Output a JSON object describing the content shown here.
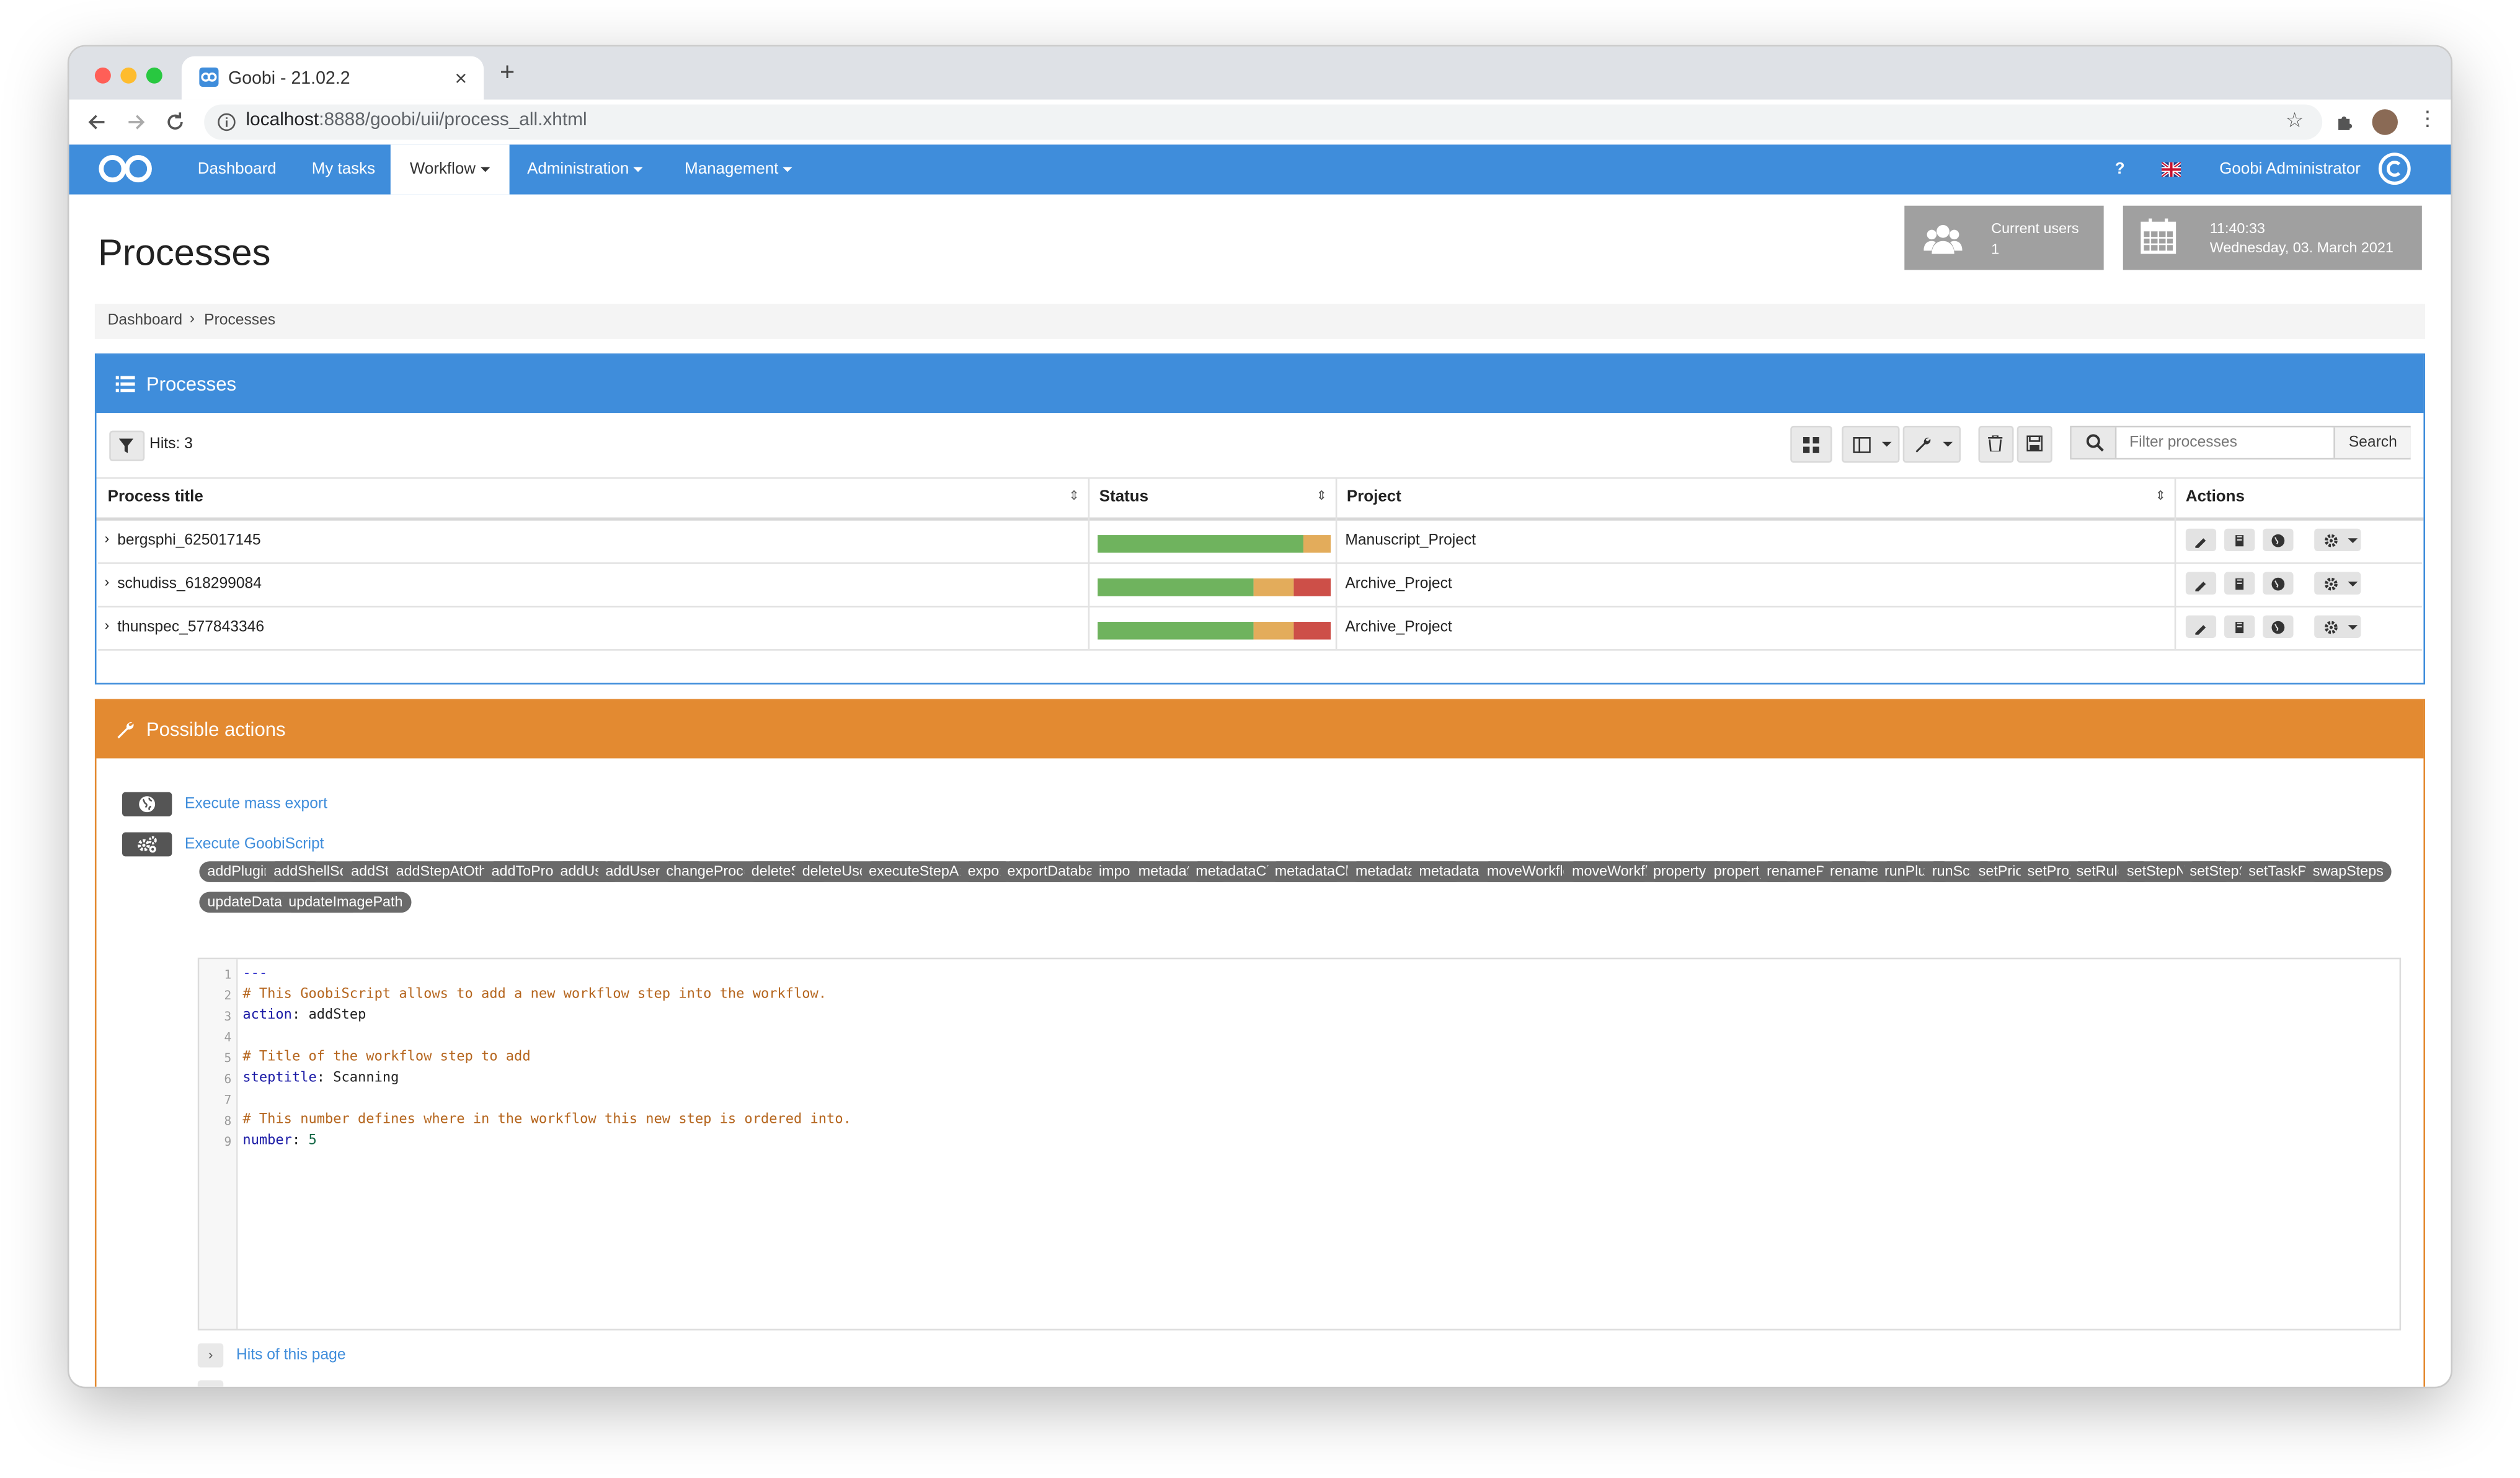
{
  "browser": {
    "tab_title": "Goobi - 21.02.2",
    "new_tab": "+",
    "url_host": "localhost",
    "url_path": ":8888/goobi/uii/process_all.xhtml",
    "colors": {
      "close": "#ff5f57",
      "minimize": "#febc2e",
      "maximize": "#28c840"
    }
  },
  "nav": {
    "items": [
      {
        "label": "Dashboard"
      },
      {
        "label": "My tasks"
      },
      {
        "label": "Workflow",
        "active": true
      },
      {
        "label": "Administration"
      },
      {
        "label": "Management"
      }
    ],
    "help": "?",
    "user": "Goobi Administrator",
    "brand_color": "#3f8ddb"
  },
  "page": {
    "title": "Processes",
    "current_users_label": "Current users",
    "current_users_count": "1",
    "time": "11:40:33",
    "date": "Wednesday, 03. March 2021"
  },
  "breadcrumb": {
    "home": "Dashboard",
    "sep": "›",
    "current": "Processes"
  },
  "processes": {
    "panel_title": "Processes",
    "hits": "Hits: 3",
    "filter_placeholder": "Filter processes",
    "search_button": "Search",
    "columns": [
      "Process title",
      "Status",
      "Project",
      "Actions"
    ],
    "rows": [
      {
        "title": "bergsphi_625017145",
        "project": "Manuscript_Project",
        "status": {
          "done": 88,
          "open": 12,
          "error": 0
        }
      },
      {
        "title": "schudiss_618299084",
        "project": "Archive_Project",
        "status": {
          "done": 67,
          "open": 17,
          "error": 16
        }
      },
      {
        "title": "thunspec_577843346",
        "project": "Archive_Project",
        "status": {
          "done": 67,
          "open": 17,
          "error": 16
        }
      }
    ],
    "status_colors": {
      "done": "#6fb35e",
      "open": "#e3ac5b",
      "error": "#cd4f48"
    }
  },
  "actions": {
    "panel_title": "Possible actions",
    "mass_export": "Execute mass export",
    "goobiscript": "Execute GoobiScript",
    "accent_color": "#e38a31",
    "scripts": [
      "addPluginToStep",
      "addShellScriptToStep",
      "addStep",
      "addStepAtOtherStepPosition",
      "addToProcessLog",
      "addUser",
      "addUserGroup",
      "changeProcessTemplate",
      "deleteStep",
      "deleteUserGroup",
      "executeStepAndUpdateStatus",
      "export",
      "exportDatabaseInformation",
      "import",
      "metadataAdd",
      "metadataChangeType",
      "metadataChangeValue",
      "metadataDelete",
      "metadataReplace",
      "moveWorkflowBackward",
      "moveWorkflowForward",
      "propertyDelete",
      "propertySet",
      "renameProcess",
      "renameStep",
      "runPlugin",
      "runScript",
      "setPriority",
      "setProject",
      "setRuleset",
      "setStepNumber",
      "setStepStatus",
      "setTaskProperty",
      "swapSteps",
      "updateDatabaseCache",
      "updateImagePath"
    ],
    "code": [
      {
        "n": "1",
        "parts": [
          {
            "t": "---",
            "c": "#3333cc"
          }
        ]
      },
      {
        "n": "2",
        "parts": [
          {
            "t": "# This GoobiScript allows to add a new workflow step into the workflow.",
            "c": "#b5651d"
          }
        ]
      },
      {
        "n": "3",
        "parts": [
          {
            "t": "action",
            "c": "#1a1aa6"
          },
          {
            "t": ": addStep",
            "c": "#222222"
          }
        ]
      },
      {
        "n": "4",
        "parts": []
      },
      {
        "n": "5",
        "parts": [
          {
            "t": "# Title of the workflow step to add",
            "c": "#b5651d"
          }
        ]
      },
      {
        "n": "6",
        "parts": [
          {
            "t": "steptitle",
            "c": "#1a1aa6"
          },
          {
            "t": ": Scanning",
            "c": "#222222"
          }
        ]
      },
      {
        "n": "7",
        "parts": []
      },
      {
        "n": "8",
        "parts": [
          {
            "t": "# This number defines where in the workflow this new step is ordered into.",
            "c": "#b5651d"
          }
        ]
      },
      {
        "n": "9",
        "parts": [
          {
            "t": "number",
            "c": "#1a1aa6"
          },
          {
            "t": ": ",
            "c": "#222222"
          },
          {
            "t": "5",
            "c": "#116644"
          }
        ]
      }
    ],
    "hits_of_page": "Hits of this page"
  }
}
